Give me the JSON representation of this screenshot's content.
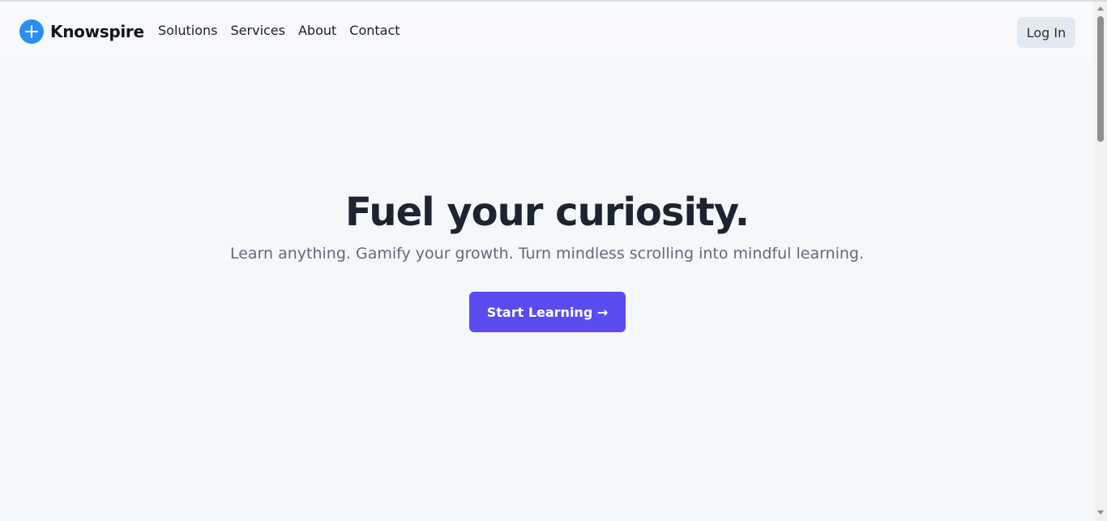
{
  "brand": {
    "name": "Knowspire",
    "logo_icon": "plus-circle-icon",
    "accent_color": "#2b8ef0"
  },
  "nav": {
    "links": [
      "Solutions",
      "Services",
      "About",
      "Contact"
    ],
    "login_label": "Log In"
  },
  "hero": {
    "title": "Fuel your curiosity.",
    "subtitle": "Learn anything. Gamify your growth. Turn mindless scrolling into mindful learning.",
    "cta_label": "Start Learning →",
    "cta_color": "#5b4cf2"
  }
}
